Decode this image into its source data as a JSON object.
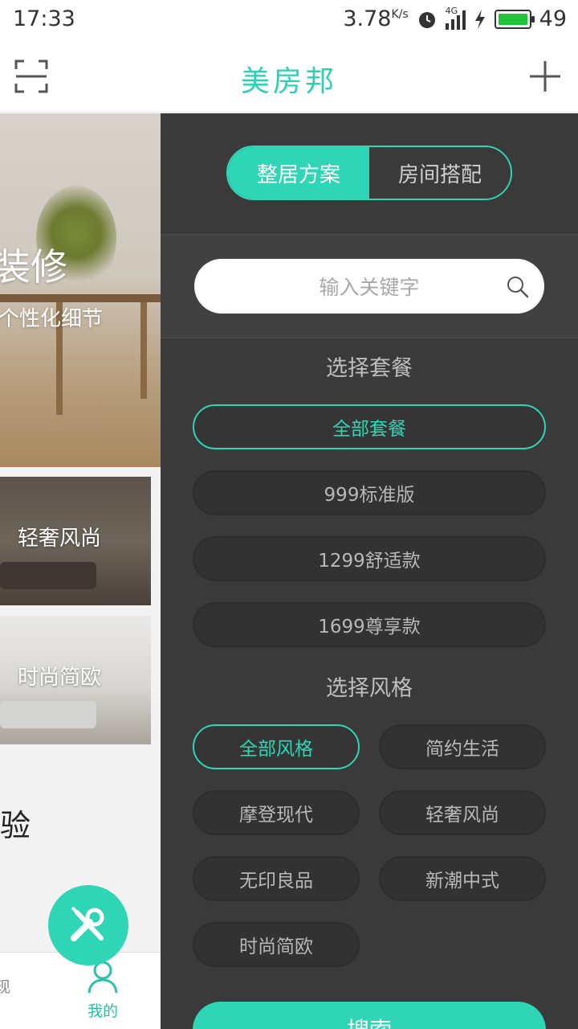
{
  "status_bar": {
    "time": "17:33",
    "speed": "3.78",
    "speed_unit": "K/s",
    "signal_label": "4G",
    "battery": "49"
  },
  "app_bar": {
    "title": "美房邦",
    "scan_icon": "scan-icon",
    "add_icon": "plus-icon"
  },
  "background_page": {
    "hero_title": "装修",
    "hero_subtitle": "个性化细节",
    "cards": [
      {
        "label": "轻奢风尚"
      },
      {
        "label": "时尚简欧"
      }
    ],
    "section_heading": "验",
    "tabbar": {
      "prev_tab_fragment": "现",
      "me_tab": "我的"
    }
  },
  "drawer": {
    "segments": [
      {
        "label": "整居方案",
        "active": true
      },
      {
        "label": "房间搭配",
        "active": false
      }
    ],
    "search": {
      "placeholder": "输入关键字"
    },
    "package_title": "选择套餐",
    "packages": [
      {
        "label": "全部套餐",
        "selected": true
      },
      {
        "label": "999标准版",
        "selected": false
      },
      {
        "label": "1299舒适款",
        "selected": false
      },
      {
        "label": "1699尊享款",
        "selected": false
      }
    ],
    "style_title": "选择风格",
    "styles": [
      {
        "label": "全部风格",
        "selected": true
      },
      {
        "label": "简约生活",
        "selected": false
      },
      {
        "label": "摩登现代",
        "selected": false
      },
      {
        "label": "轻奢风尚",
        "selected": false
      },
      {
        "label": "无印良品",
        "selected": false
      },
      {
        "label": "新潮中式",
        "selected": false
      },
      {
        "label": "时尚简欧",
        "selected": false
      }
    ],
    "search_button": "搜索"
  },
  "colors": {
    "accent": "#2ed6b5",
    "drawer_bg": "#3a3a3a",
    "pill_bg": "#323232"
  }
}
